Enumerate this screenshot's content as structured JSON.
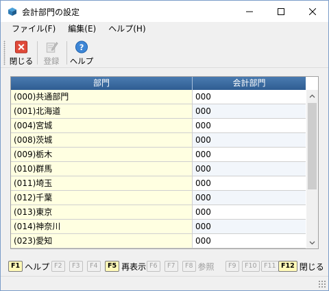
{
  "window": {
    "title": "会計部門の設定"
  },
  "menu": {
    "items": [
      "ファイル(F)",
      "編集(E)",
      "ヘルプ(H)"
    ]
  },
  "toolbar": {
    "close_label": "閉じる",
    "register_label": "登録",
    "help_label": "ヘルプ"
  },
  "grid": {
    "columns": [
      "部門",
      "会計部門"
    ],
    "rows": [
      [
        "(000)共通部門",
        "000"
      ],
      [
        "(001)北海道",
        "000"
      ],
      [
        "(004)宮城",
        "000"
      ],
      [
        "(008)茨城",
        "000"
      ],
      [
        "(009)栃木",
        "000"
      ],
      [
        "(010)群馬",
        "000"
      ],
      [
        "(011)埼玉",
        "000"
      ],
      [
        "(012)千葉",
        "000"
      ],
      [
        "(013)東京",
        "000"
      ],
      [
        "(014)神奈川",
        "000"
      ],
      [
        "(023)愛知",
        "000"
      ]
    ]
  },
  "fkeys": {
    "f1": {
      "key": "F1",
      "label": "ヘルプ"
    },
    "f2": {
      "key": "F2"
    },
    "f3": {
      "key": "F3"
    },
    "f4": {
      "key": "F4"
    },
    "f5": {
      "key": "F5",
      "label": "再表示"
    },
    "f6": {
      "key": "F6"
    },
    "f7": {
      "key": "F7"
    },
    "f8": {
      "key": "F8",
      "label": "参照"
    },
    "f9": {
      "key": "F9"
    },
    "f10": {
      "key": "F10"
    },
    "f11": {
      "key": "F11"
    },
    "f12": {
      "key": "F12",
      "label": "閉じる"
    }
  },
  "colors": {
    "header_blue": "#2f5d92",
    "row_highlight": "#ffffe1",
    "fkey_active": "#fff9b8"
  }
}
